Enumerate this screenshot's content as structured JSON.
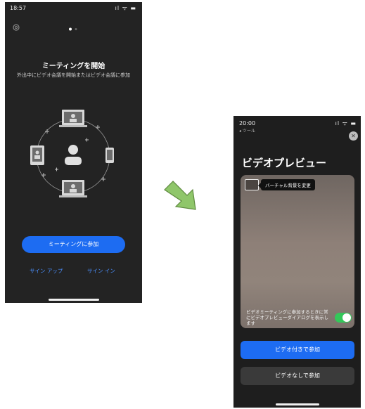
{
  "phone1": {
    "status_time": "18:57",
    "status_icons": "ıl ᯤ ▬",
    "title": "ミーティングを開始",
    "subtitle": "外出中にビデオ会議を開始またはビデオ会議に参加",
    "join_button": "ミーティングに参加",
    "signup_link": "サイン アップ",
    "signin_link": "サイン イン"
  },
  "phone2": {
    "status_time": "20:00",
    "back_label": "◂ ツール",
    "status_icons": "ıl ᯤ ▬",
    "title": "ビデオプレビュー",
    "background_tooltip": "バーチャル背景を変更",
    "toggle_text": "ビデオミーティングに参加するときに常にビデオプレビューダイアログを表示します",
    "toggle_on": true,
    "join_with_video": "ビデオ付きで参加",
    "join_without_video": "ビデオなしで参加"
  },
  "colors": {
    "accent": "#1d6cf2",
    "toggle": "#33c759",
    "arrow": "#8fc66a"
  }
}
